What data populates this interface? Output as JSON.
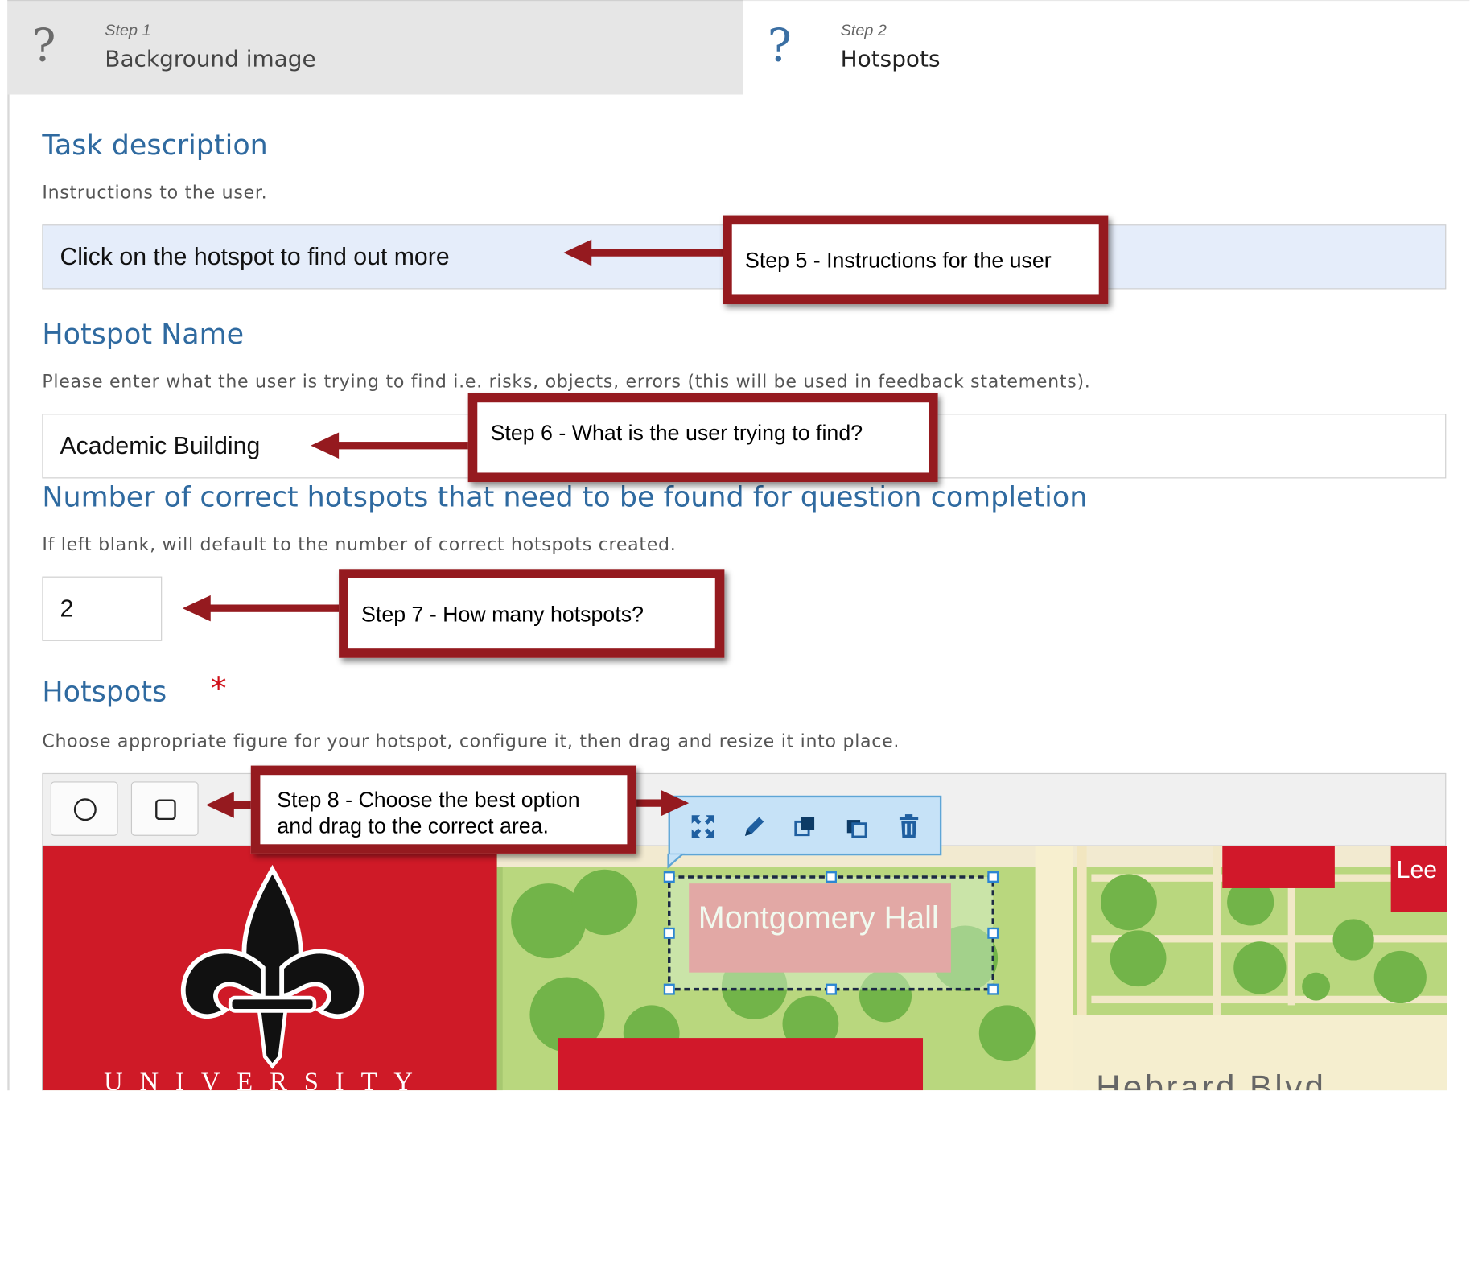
{
  "steps": [
    {
      "step_label": "Step 1",
      "title": "Background image",
      "icon": "question-icon"
    },
    {
      "step_label": "Step 2",
      "title": "Hotspots",
      "icon": "question-icon"
    }
  ],
  "task_description": {
    "heading": "Task description",
    "help": "Instructions to the user.",
    "value": "Click on the hotspot to find out more"
  },
  "hotspot_name": {
    "heading": "Hotspot Name",
    "help": "Please enter what the user is trying to find i.e. risks, objects, errors (this will be used in feedback statements).",
    "value": "Academic Building"
  },
  "correct_count": {
    "heading": "Number of correct hotspots that need to be found for question completion",
    "help": "If left blank, will default to the number of correct hotspots created.",
    "value": "2"
  },
  "hotspots": {
    "heading": "Hotspots",
    "required_mark": "*",
    "help": "Choose appropriate figure for your hotspot, configure it, then drag and resize it into place.",
    "tools": [
      "circle-tool-icon",
      "rectangle-tool-icon"
    ],
    "hotspot_actions": [
      "move-icon",
      "edit-icon",
      "bring-front-icon",
      "send-back-icon",
      "delete-icon"
    ]
  },
  "map": {
    "labels": {
      "building": "Montgomery Hall",
      "corner": "Lee",
      "street": "Hebrard Blvd",
      "university": "UNIVERSITY"
    }
  },
  "callouts": {
    "step5": "Step 5 - Instructions for the user",
    "step6": "Step 6 - What is the user trying to find?",
    "step7": "Step 7 - How many hotspots?",
    "step8_line1": "Step 8 - Choose the best option",
    "step8_line2": "and drag to the correct area."
  },
  "colors": {
    "heading": "#2f6aa0",
    "callout_border": "#951a1f",
    "required": "#d0111a",
    "selected_field": "#e5edfa"
  }
}
